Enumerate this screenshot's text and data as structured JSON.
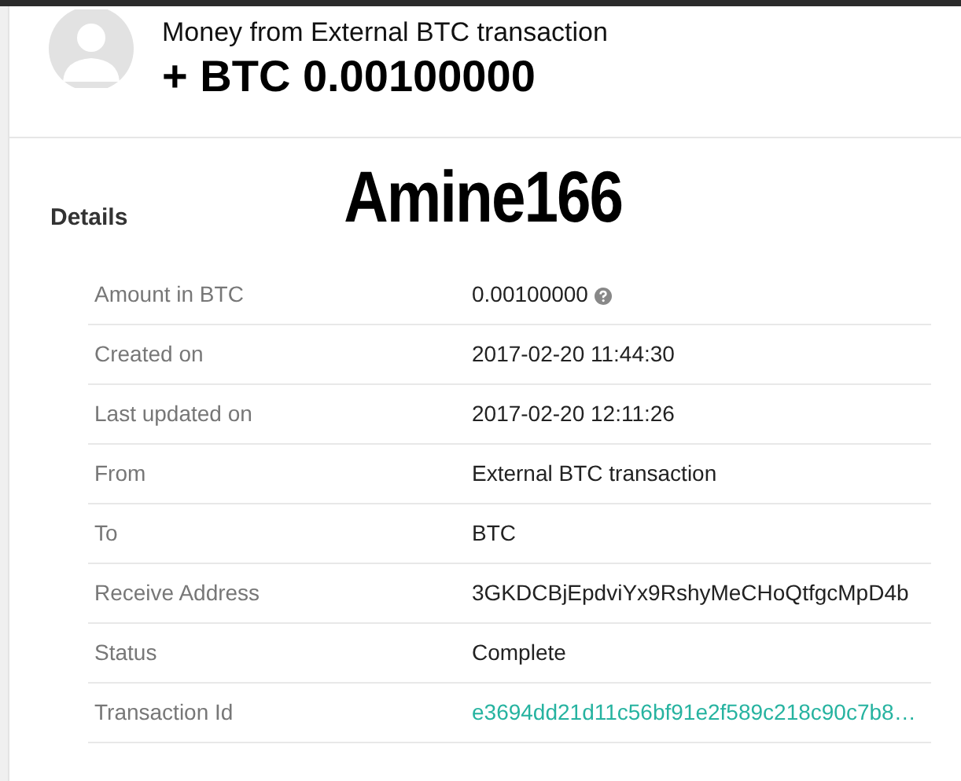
{
  "header": {
    "title": "Money from External BTC transaction",
    "amount": "+ BTC 0.00100000"
  },
  "overlay_text": "Amine166",
  "details": {
    "heading": "Details",
    "rows": [
      {
        "label": "Amount in BTC",
        "value": "0.00100000",
        "kind": "help"
      },
      {
        "label": "Created on",
        "value": "2017-02-20 11:44:30",
        "kind": "text"
      },
      {
        "label": "Last updated on",
        "value": "2017-02-20 12:11:26",
        "kind": "text"
      },
      {
        "label": "From",
        "value": "External BTC transaction",
        "kind": "text"
      },
      {
        "label": "To",
        "value": "BTC",
        "kind": "text"
      },
      {
        "label": "Receive Address",
        "value": "3GKDCBjEpdviYx9RshyMeCHoQtfgcMpD4b",
        "kind": "text"
      },
      {
        "label": "Status",
        "value": "Complete",
        "kind": "text"
      },
      {
        "label": "Transaction Id",
        "value": "e3694dd21d11c56bf91e2f589c218c90c7b8…",
        "kind": "link"
      }
    ]
  }
}
